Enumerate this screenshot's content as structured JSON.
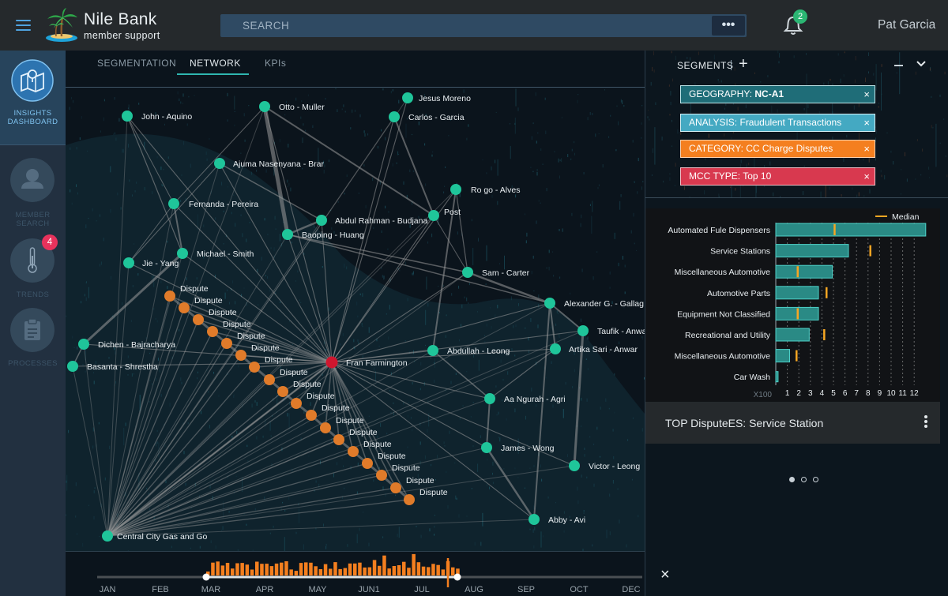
{
  "header": {
    "brand_name": "Nile Bank",
    "brand_sub": "member support",
    "search_placeholder": "SEARCH",
    "search_more_label": "•••",
    "notification_count": "2",
    "user_name": "Pat Garcia"
  },
  "nav": {
    "insights_label_1": "INSIGHTS",
    "insights_label_2": "DASHBOARD",
    "member_label_1": "MEMBER",
    "member_label_2": "SEARCH",
    "trends_label": "TRENDS",
    "trends_badge": "4",
    "processes_label": "PROCESSES"
  },
  "tabs": [
    {
      "label": "SEGMENTATION",
      "active": false
    },
    {
      "label": "NETWORK",
      "active": true
    },
    {
      "label": "KPIs",
      "active": false
    }
  ],
  "network": {
    "hub": {
      "label": "Fran Farmington",
      "id": "hub"
    },
    "members": [
      {
        "id": "m1",
        "label": "John - Aquino"
      },
      {
        "id": "m2",
        "label": "Otto - Muller"
      },
      {
        "id": "m3",
        "label": "Jesus Moreno"
      },
      {
        "id": "m4",
        "label": "Carlos - Garcia"
      },
      {
        "id": "m5",
        "label": "Ajuma Nasenyana - Brar"
      },
      {
        "id": "m6",
        "label": "Ro go - Alves"
      },
      {
        "id": "m7",
        "label": "Fernanda - Pereira"
      },
      {
        "id": "m8",
        "label": "Abdul Rahman - Budjana"
      },
      {
        "id": "m9",
        "label": "Post"
      },
      {
        "id": "m10",
        "label": "Baoping - Huang"
      },
      {
        "id": "m11",
        "label": "Michael - Smith"
      },
      {
        "id": "m12",
        "label": "Jie - Yang"
      },
      {
        "id": "m13",
        "label": "Sam - Carter"
      },
      {
        "id": "m14",
        "label": "Alexander G. - Gallag"
      },
      {
        "id": "m15",
        "label": "Taufik - Anwa"
      },
      {
        "id": "m16",
        "label": "Artika Sari - Anwar"
      },
      {
        "id": "m17",
        "label": "Dichen - Bajracharya"
      },
      {
        "id": "m18",
        "label": "Basanta - Shrestha"
      },
      {
        "id": "m19",
        "label": "Abdullah - Leong"
      },
      {
        "id": "m20",
        "label": "Aa Ngurah - Agri"
      },
      {
        "id": "m21",
        "label": "James - Wong"
      },
      {
        "id": "m22",
        "label": "Victor - Leong"
      },
      {
        "id": "m23",
        "label": "Abby - Avi"
      },
      {
        "id": "m24",
        "label": "Central City Gas and Go"
      }
    ],
    "dispute_label": "Dispute",
    "dispute_count": 18
  },
  "segments": {
    "title": "SEGMENTS",
    "chips": [
      {
        "prefix": "GEOGRAPHY:",
        "value": "NC-A1",
        "bold_value": true,
        "bg": "#1f6d78",
        "border": "#bfe6ea",
        "color": "#ffffff"
      },
      {
        "prefix": "ANALYSIS:",
        "value": "Fraudulent Transactions",
        "bold_value": false,
        "bg": "#44a9c2",
        "border": "#d5f0f6",
        "color": "#ffffff"
      },
      {
        "prefix": "CATEGORY:",
        "value": "CC Charge Disputes",
        "bold_value": false,
        "bg": "#f47f1f",
        "border": "#fbd2b0",
        "color": "#ffffff"
      },
      {
        "prefix": "MCC TYPE:",
        "value": "Top 10",
        "bold_value": false,
        "bg": "#d8394f",
        "border": "#f4c0c8",
        "color": "#ffffff"
      }
    ],
    "chip_close": "×"
  },
  "chart_data": {
    "type": "bar",
    "title": "",
    "legend": [
      "Median"
    ],
    "xlabel": "",
    "x_multiplier_label": "X100",
    "xlim": [
      0,
      13
    ],
    "xticks": [
      "1",
      "2",
      "3",
      "4",
      "5",
      "6",
      "7",
      "8",
      "9",
      "10",
      "11",
      "12"
    ],
    "categories": [
      "Automated Fule Dispensers",
      "Service Stations",
      "Miscellaneous Automotive",
      "Automotive Parts",
      "Equipment Not  Classified",
      "Recreational and Utility",
      "Miscellaneous Automotive",
      "Car Wash"
    ],
    "values": [
      13,
      6.3,
      4.9,
      3.7,
      3.7,
      2.9,
      1.2,
      0.2
    ],
    "median": [
      5.1,
      8.2,
      1.9,
      4.4,
      1.9,
      4.2,
      1.8,
      null
    ],
    "colors": {
      "bar": "#2a8a85",
      "bar_edge": "#4ed1c8",
      "median": "#f5a623"
    }
  },
  "chart_footer": {
    "title": "TOP DisputeES: Service Station"
  },
  "timeline": {
    "months": [
      "JAN",
      "FEB",
      "MAR",
      "APR",
      "MAY",
      "JUN1",
      "JUL",
      "AUG",
      "SEP",
      "OCT",
      "DEC"
    ],
    "range_start": "MAR",
    "range_end": "AUG",
    "close_label": "×",
    "bar_color": "#f47f1f"
  }
}
